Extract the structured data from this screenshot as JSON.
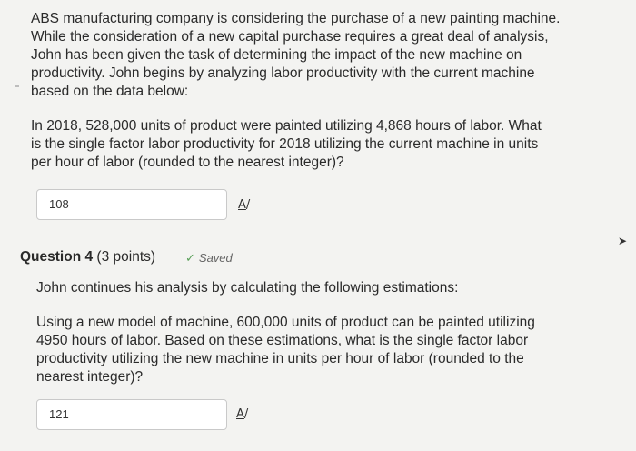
{
  "intro": {
    "lines": [
      "ABS manufacturing company is considering the purchase of a new painting machine.",
      "While the consideration of a new capital purchase requires a great deal of analysis,",
      "John has been given the task of determining the impact of the new machine on",
      "productivity. John begins by analyzing labor productivity with the current machine",
      "based on the data below:"
    ]
  },
  "question3": {
    "lines": [
      "In 2018, 528,000 units of product were painted utilizing 4,868 hours of labor. What",
      "is the single factor labor productivity for 2018 utilizing the current machine in units",
      "per hour of labor (rounded to the nearest integer)?"
    ],
    "answer_value": "108"
  },
  "question4": {
    "title": "Question 4",
    "points": "(3 points)",
    "saved_label": "Saved",
    "intro": "John continues his analysis by calculating the following estimations:",
    "lines": [
      "Using a new model of machine, 600,000 units of product can be painted utilizing",
      "4950 hours of labor. Based on these estimations, what is the single factor labor",
      "productivity utilizing the new machine in units per hour of labor (rounded to the",
      "nearest integer)?"
    ],
    "answer_value": "121"
  },
  "icons": {
    "spellcheck": "spellcheck-icon",
    "check": "check-icon",
    "cursor": "mouse-cursor-icon"
  }
}
